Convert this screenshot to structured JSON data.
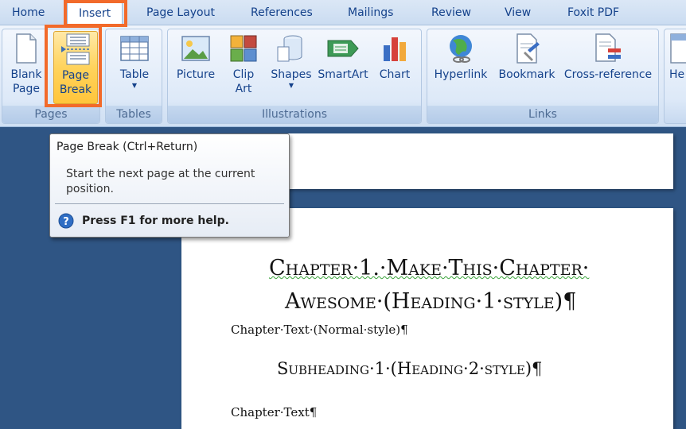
{
  "tabs": [
    {
      "label": "Home"
    },
    {
      "label": "Insert",
      "active": true
    },
    {
      "label": "Page Layout"
    },
    {
      "label": "References"
    },
    {
      "label": "Mailings"
    },
    {
      "label": "Review"
    },
    {
      "label": "View"
    },
    {
      "label": "Foxit PDF"
    }
  ],
  "ribbon": {
    "groups": {
      "pages": "Pages",
      "tables": "Tables",
      "illustrations": "Illustrations",
      "links": "Links"
    },
    "buttons": {
      "blank_page": [
        "Blank",
        "Page"
      ],
      "page_break": [
        "Page",
        "Break"
      ],
      "table": "Table",
      "picture": "Picture",
      "clip_art": [
        "Clip",
        "Art"
      ],
      "shapes": "Shapes",
      "smartart": "SmartArt",
      "chart": "Chart",
      "hyperlink": "Hyperlink",
      "bookmark": "Bookmark",
      "cross_reference": "Cross-reference",
      "header_partial": "He"
    }
  },
  "tooltip": {
    "title": "Page Break (Ctrl+Return)",
    "description": "Start the next page at the current position.",
    "help": "Press F1 for more help."
  },
  "document": {
    "heading1_line1": "Chapter·1.·Make·This·Chapter·",
    "heading1_line2": "Awesome·(Heading·1·style)¶",
    "chapter_text": "Chapter·Text·(Normal·style)¶",
    "subheading": "Subheading·1·(Heading·2·style)¶",
    "chapter_text_2": "Chapter·Text¶"
  },
  "colors": {
    "highlight": "#f26a2a",
    "ribbon_text": "#15428b",
    "background": "#2f5584"
  }
}
